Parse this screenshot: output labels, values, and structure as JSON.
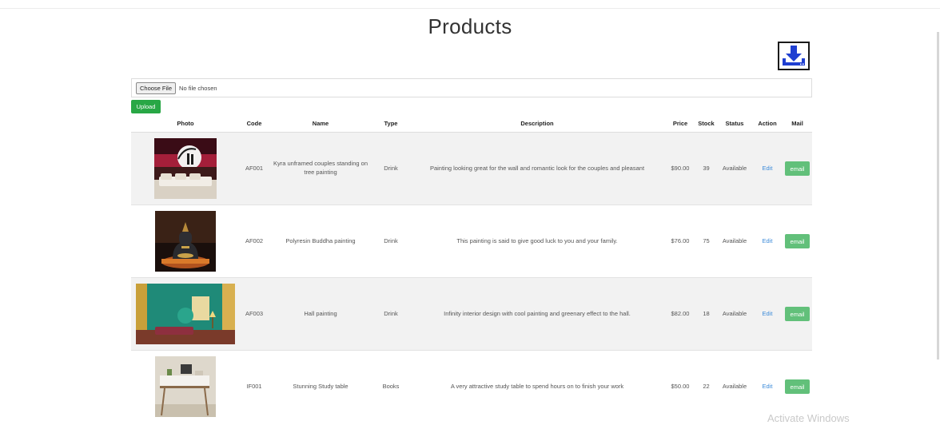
{
  "page": {
    "title": "Products"
  },
  "toolbar": {
    "download_icon": "download-icon",
    "choose_file_label": "Choose File",
    "file_status": "No file chosen",
    "upload_label": "Upload"
  },
  "table": {
    "headers": [
      "Photo",
      "Code",
      "Name",
      "Type",
      "Description",
      "Price",
      "Stock",
      "Status",
      "Action",
      "Mail"
    ],
    "rows": [
      {
        "code": "AF001",
        "name": "Kyra unframed couples standing on tree painting",
        "type": "Drink",
        "description": "Painting looking great for the wall and romantic look for the couples and pleasant",
        "price": "$90.00",
        "stock": "39",
        "status": "Available",
        "action": "Edit",
        "mail": "email"
      },
      {
        "code": "AF002",
        "name": "Polyresin Buddha painting",
        "type": "Drink",
        "description": "This painting is said to give good luck to you and your family.",
        "price": "$76.00",
        "stock": "75",
        "status": "Available",
        "action": "Edit",
        "mail": "email"
      },
      {
        "code": "AF003",
        "name": "Hall painting",
        "type": "Drink",
        "description": "Infinity interior design with cool painting and greenary effect to the hall.",
        "price": "$82.00",
        "stock": "18",
        "status": "Available",
        "action": "Edit",
        "mail": "email"
      },
      {
        "code": "IF001",
        "name": "Stunning Study table",
        "type": "Books",
        "description": "A very attractive study table to spend hours on to finish your work",
        "price": "$50.00",
        "stock": "22",
        "status": "Available",
        "action": "Edit",
        "mail": "email"
      }
    ]
  },
  "watermark": "Activate Windows",
  "colors": {
    "upload_green": "#28a745",
    "email_green": "#62c07a",
    "edit_link_blue": "#3d8bd9",
    "download_blue": "#1f3fd1"
  }
}
